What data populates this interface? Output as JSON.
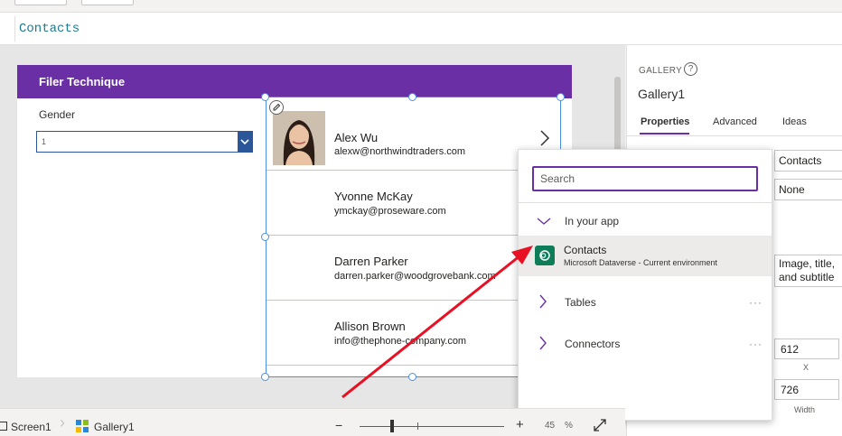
{
  "formula": {
    "value": "Contacts"
  },
  "screen": {
    "header_title": "Filer Technique",
    "gender_label": "Gender",
    "dropdown_value": "1"
  },
  "gallery": {
    "rows": [
      {
        "name": "Alex Wu",
        "email": "alexw@northwindtraders.com"
      },
      {
        "name": "Yvonne McKay",
        "email": "ymckay@proseware.com"
      },
      {
        "name": "Darren Parker",
        "email": "darren.parker@woodgrovebank.com"
      },
      {
        "name": "Allison Brown",
        "email": "info@thephone-company.com"
      }
    ]
  },
  "right_panel": {
    "kicker": "GALLERY",
    "help": "?",
    "name": "Gallery1",
    "tabs": [
      "Properties",
      "Advanced",
      "Ideas"
    ],
    "fields": {
      "data_source": "Contacts",
      "fields_value": "None",
      "layout": "Image, title, and subtitle",
      "x": "612",
      "x_label": "X",
      "width": "726",
      "width_label": "Width"
    }
  },
  "popup": {
    "search_placeholder": "Search",
    "in_your_app": "In your app",
    "item_label": "Contacts",
    "item_sub": "Microsoft Dataverse - Current environment",
    "tables": "Tables",
    "connectors": "Connectors",
    "more": "···"
  },
  "statusbar": {
    "screen": "Screen1",
    "gallery": "Gallery1",
    "minus": "−",
    "plus": "+",
    "zoom": "45",
    "percent": "%"
  },
  "colors": {
    "header_purple": "#6b2fa5",
    "accent_blue": "#2b579a",
    "dataverse_green": "#0c7c59",
    "arrow_red": "#e81123"
  }
}
